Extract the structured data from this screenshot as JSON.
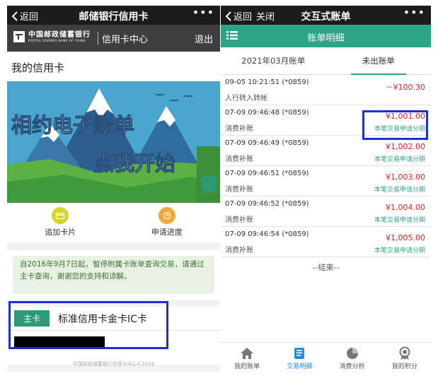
{
  "left": {
    "topbar": {
      "back_label": "返回",
      "title": "邮储银行信用卡",
      "more": "•••"
    },
    "bankbar": {
      "logo_cn": "中国邮政储蓄银行",
      "logo_en": "POSTAL SAVINGS BANK OF CHINA",
      "center_label": "信用卡中心",
      "logout_label": "退出"
    },
    "my_cards_title": "我的信用卡",
    "banner": {
      "line1": "相约电子账单",
      "line2": "点我开始"
    },
    "actions": [
      {
        "label": "追加卡片",
        "icon": "card-icon"
      },
      {
        "label": "申请进度",
        "icon": "progress-icon"
      }
    ],
    "notice": "自2016年9月7日起，暂停附属卡账单查询交易，请通过主卡查询，谢谢您的支持和谅解。",
    "card": {
      "tag": "主卡",
      "name": "标准信用卡金卡IC卡"
    },
    "footer": "中国邮政储蓄银行信用卡中心©2016"
  },
  "right": {
    "topbar": {
      "back_label": "返回",
      "close_label": "关闭",
      "title": "交互式账单",
      "more": "•••"
    },
    "subheader": {
      "title": "账单明细",
      "menu_icon": "list-menu-icon"
    },
    "tabs": [
      {
        "label": "2021年03月账单",
        "active": false
      },
      {
        "label": "未出账单",
        "active": true
      }
    ],
    "transactions": [
      {
        "datetime": "09-05 10:21:51 (*0859)",
        "desc": "人行转入转帐",
        "amount": "－¥100.30",
        "installment": ""
      },
      {
        "datetime": "07-09 09:46:48 (*0859)",
        "desc": "消费补账",
        "amount": "¥1,001.00",
        "installment": "本笔交易申请分期"
      },
      {
        "datetime": "07-09 09:46:49 (*0859)",
        "desc": "消费补账",
        "amount": "¥1,002.00",
        "installment": "本笔交易申请分期"
      },
      {
        "datetime": "07-09 09:46:51 (*0859)",
        "desc": "消费补账",
        "amount": "¥1,003.00",
        "installment": "本笔交易申请分期"
      },
      {
        "datetime": "07-09 09:46:52 (*0859)",
        "desc": "消费补账",
        "amount": "¥1,004.00",
        "installment": "本笔交易申请分期"
      },
      {
        "datetime": "07-09 09:46:54 (*0859)",
        "desc": "消费补账",
        "amount": "¥1,005.00",
        "installment": "本笔交易申请分期"
      }
    ],
    "end_label": "--结束--",
    "nav": [
      {
        "label": "我的账单",
        "icon": "home-icon",
        "active": false
      },
      {
        "label": "交易明细",
        "icon": "book-icon",
        "active": true
      },
      {
        "label": "消费分析",
        "icon": "pie-chart-icon",
        "active": false
      },
      {
        "label": "我的积分",
        "icon": "medal-icon",
        "active": false
      }
    ]
  },
  "colors": {
    "accent_green": "#2ba585",
    "amount_red": "#e02020",
    "highlight_blue": "#1f2fd3",
    "nav_active": "#2b8fd8"
  }
}
